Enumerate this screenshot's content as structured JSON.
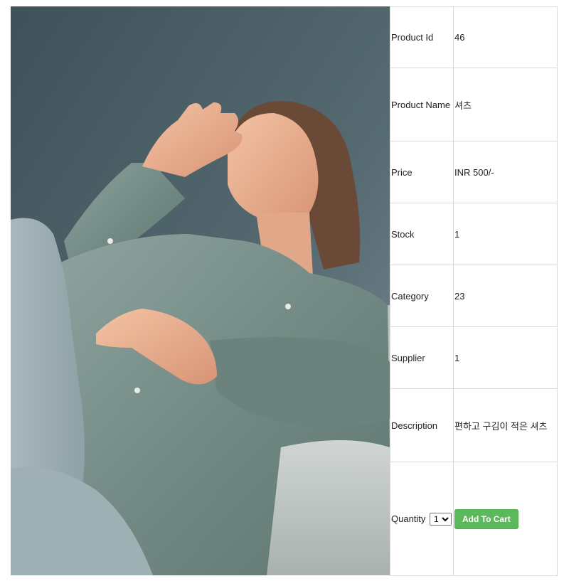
{
  "product": {
    "image_alt": "Woman in a sage green shirt leaning back on a sofa",
    "rows": [
      {
        "label": "Product Id",
        "value": "46"
      },
      {
        "label": "Product Name",
        "value": "셔츠"
      },
      {
        "label": "Price",
        "value": "INR 500/-"
      },
      {
        "label": "Stock",
        "value": "1"
      },
      {
        "label": "Category",
        "value": "23"
      },
      {
        "label": "Supplier",
        "value": "1"
      },
      {
        "label": "Description",
        "value": "편하고 구김이 적은 셔츠"
      }
    ],
    "quantity_label": "Quantity",
    "quantity_selected": "1",
    "add_to_cart_label": "Add To Cart",
    "colors": {
      "button": "#5cb85c",
      "border": "#dcdcdc",
      "photo_wall": "#4d6068",
      "shirt": "#7e958f"
    }
  }
}
